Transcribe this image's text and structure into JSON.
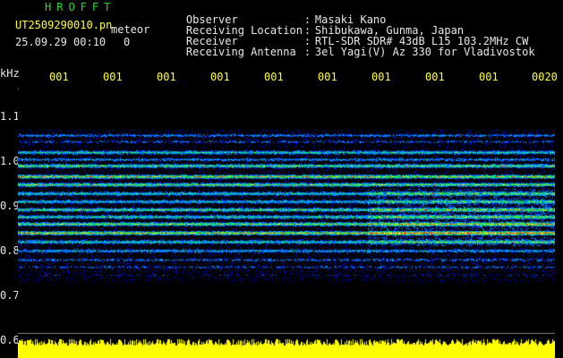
{
  "brand": "HROFFT",
  "file": {
    "name": "UT2509290010.pn",
    "suffix": "meteor",
    "datetime": "25.09.29 00:10",
    "counter": "0"
  },
  "meta": {
    "rows": [
      {
        "label": "Observer",
        "value": "Masaki Kano"
      },
      {
        "label": "Receiving Location",
        "value": "Shibukawa, Gunma, Japan"
      },
      {
        "label": "Receiver",
        "value": "RTL-SDR SDR# 43dB L15 103.2MHz CW"
      },
      {
        "label": "Receiving Antenna",
        "value": "3el Yagi(V) Az 330 for Vladivostok"
      }
    ]
  },
  "axis": {
    "unit": "kHz",
    "y_labels": [
      "1.1",
      "1.0",
      "0.9",
      "0.8",
      "0.7",
      "0.6"
    ],
    "time_labels": [
      "001",
      "001",
      "001",
      "001",
      "001",
      "001",
      "001",
      "001",
      "001",
      "0020"
    ]
  },
  "colors": {
    "background": "#000000",
    "brand": "#2fd62f",
    "header_text": "#e8e8e8",
    "time_labels": "#ffff40",
    "signal_strong": "#ff2020",
    "signal_mid": "#20ff40",
    "signal_low": "#2040ff",
    "noise_floor": "#ffff00"
  }
}
